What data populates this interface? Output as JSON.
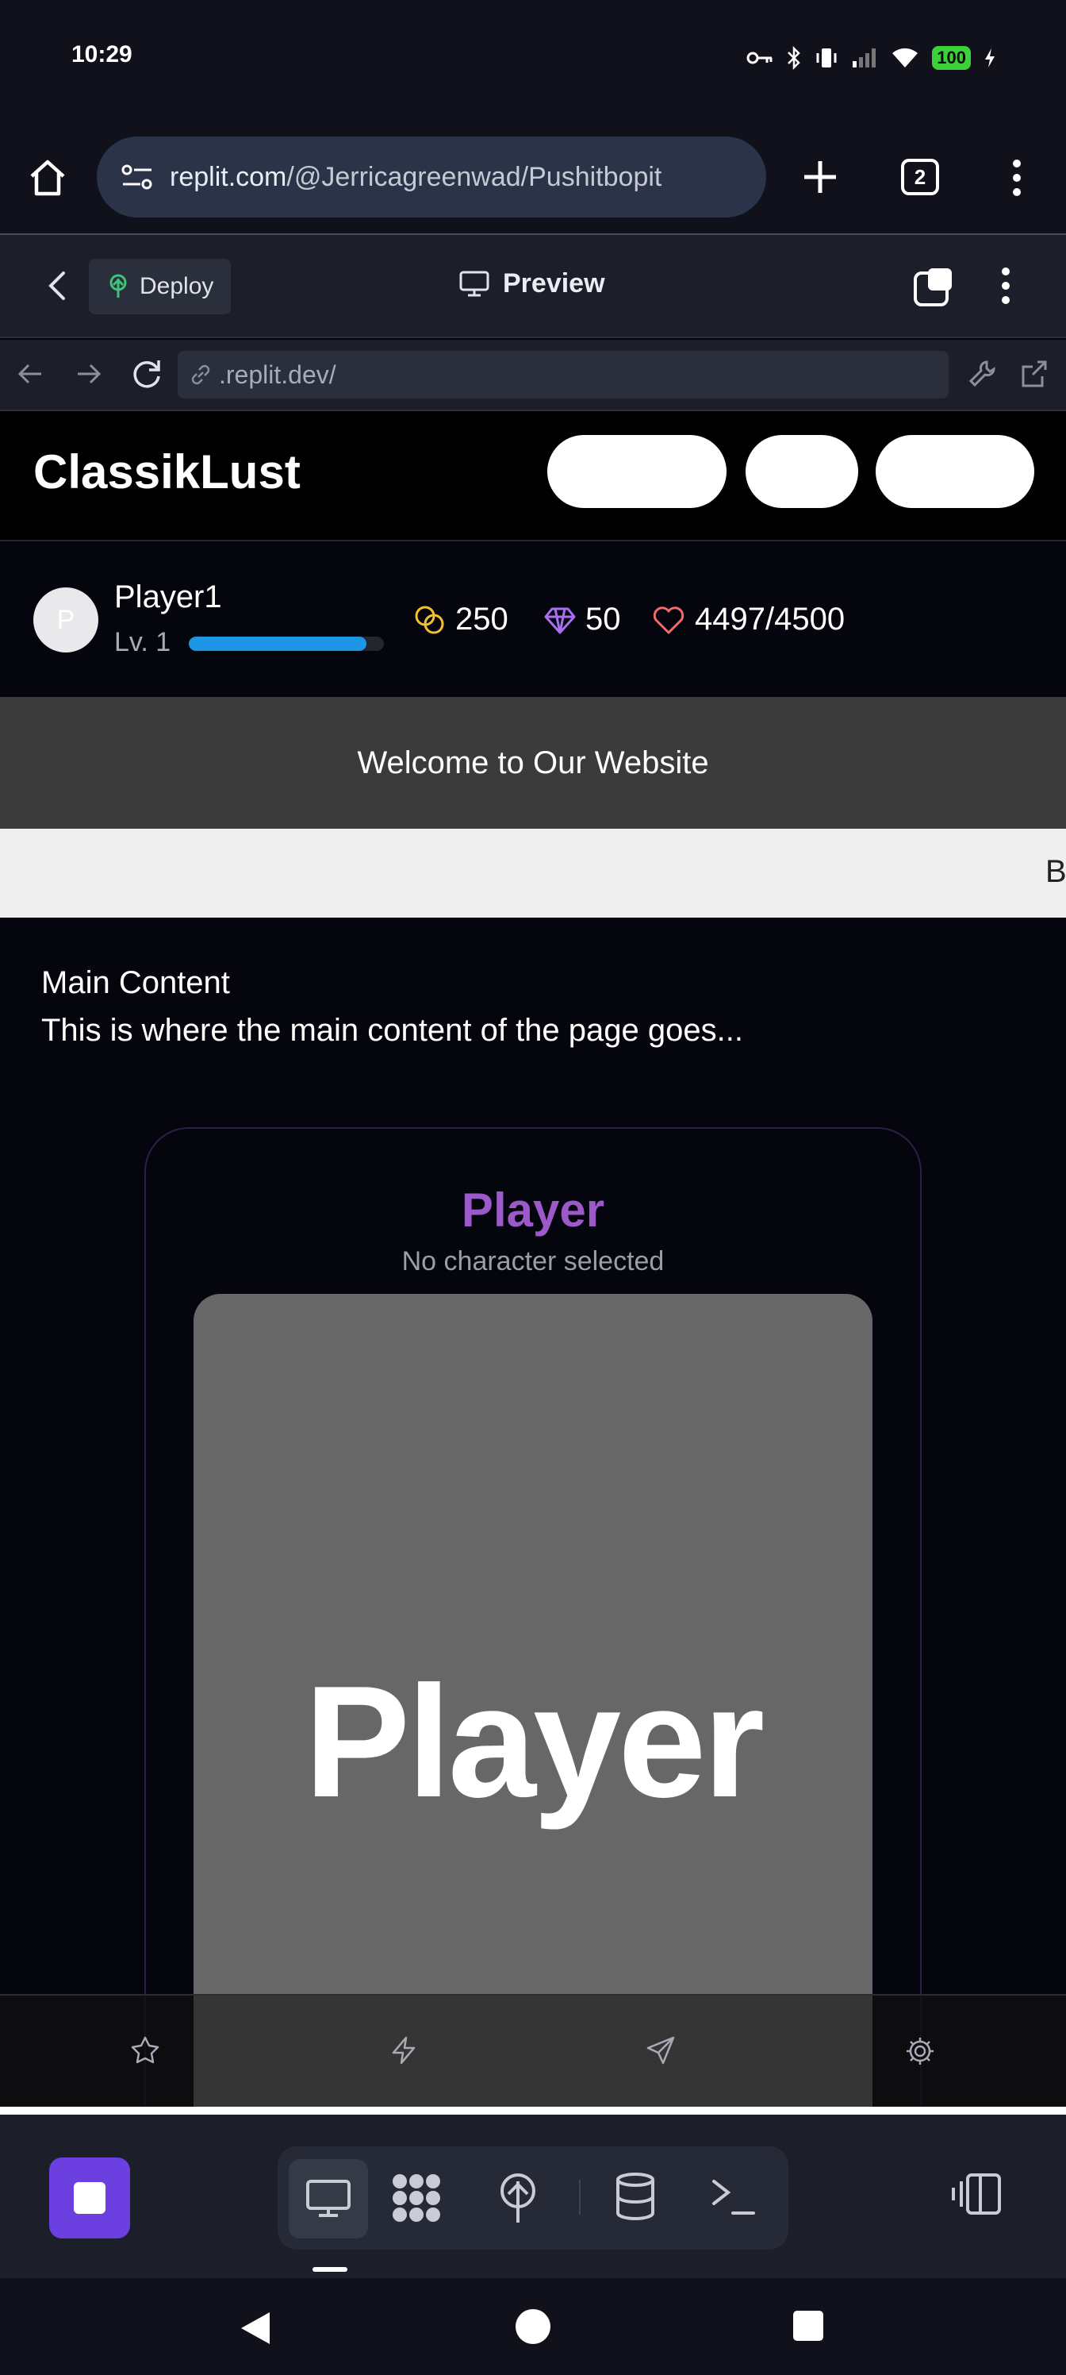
{
  "status_bar": {
    "time": "10:29",
    "battery": "100"
  },
  "browser": {
    "url_host": "replit.com",
    "url_path": "/@Jerricagreenwad/Pushitbopit",
    "tab_count": "2"
  },
  "replit_header": {
    "deploy_label": "Deploy",
    "preview_label": "Preview"
  },
  "webview": {
    "url": ".replit.dev/"
  },
  "site": {
    "logo": "ClassikLust",
    "player": {
      "avatar_initial": "P",
      "name": "Player1",
      "level": "Lv. 1",
      "xp_progress": 0.91,
      "coins": "250",
      "gems": "50",
      "health": "4497/4500"
    },
    "welcome": "Welcome to Our Website",
    "marquee": "B",
    "main_title": "Main Content",
    "main_desc": "This is where the main content of the page goes...",
    "card": {
      "title": "Player",
      "subtitle": "No character selected",
      "image_text": "Player"
    },
    "bottom_nav": [
      "star-icon",
      "bolt-icon",
      "send-icon",
      "gear-icon"
    ]
  },
  "colors": {
    "accent_purple": "#9b59c9",
    "xp_blue": "#1e96e6",
    "coin_yellow": "#f2c12e",
    "gem_purple": "#a870f0",
    "heart_red": "#f26a6a",
    "run_button": "#6b3fe0"
  }
}
